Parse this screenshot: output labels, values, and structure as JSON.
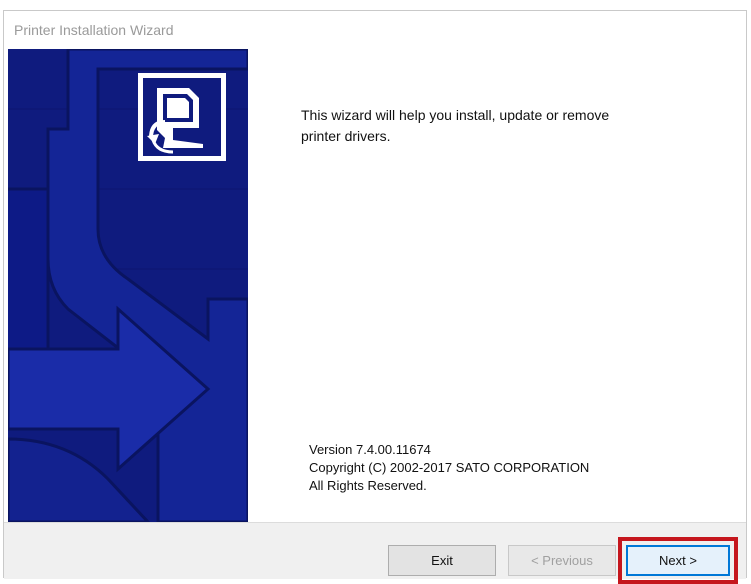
{
  "window": {
    "title": "Printer Installation Wizard"
  },
  "content": {
    "intro_line1": "This wizard will help you install, update or remove",
    "intro_line2": "printer drivers.",
    "version": "Version 7.4.00.11674",
    "copyright": "Copyright (C) 2002-2017 SATO CORPORATION",
    "rights": "All Rights Reserved."
  },
  "footer": {
    "exit_label": "Exit",
    "previous_label": "< Previous",
    "next_label": "Next >"
  },
  "colors": {
    "panel_blue": "#0f1b7e",
    "highlight_red": "#c5161d",
    "focus_blue": "#0078d7"
  },
  "icons": {
    "wizard_logo": "printer-icon"
  }
}
